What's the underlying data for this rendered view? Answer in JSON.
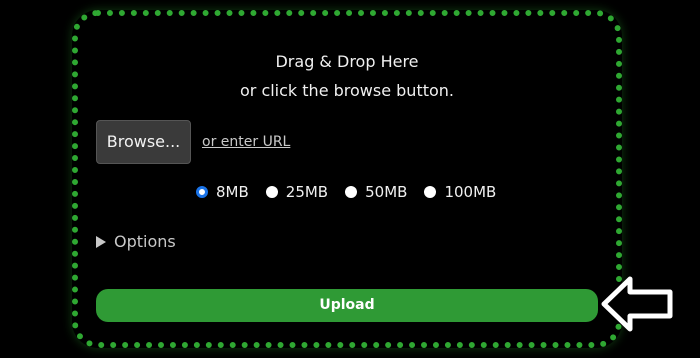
{
  "dropzone": {
    "line1": "Drag & Drop Here",
    "line2": "or click the browse button."
  },
  "browse": {
    "label": "Browse...",
    "url_link": "or enter URL"
  },
  "size_options": [
    {
      "label": "8MB",
      "checked": true
    },
    {
      "label": "25MB",
      "checked": false
    },
    {
      "label": "50MB",
      "checked": false
    },
    {
      "label": "100MB",
      "checked": false
    }
  ],
  "options": {
    "label": "Options"
  },
  "upload": {
    "label": "Upload"
  },
  "colors": {
    "accent_green": "#2fa832",
    "button_green": "#2f9a35",
    "radio_blue": "#1a73e8",
    "background": "#000000"
  },
  "icons": {
    "options_toggle": "triangle-right-icon",
    "pointer": "arrow-left-icon"
  }
}
